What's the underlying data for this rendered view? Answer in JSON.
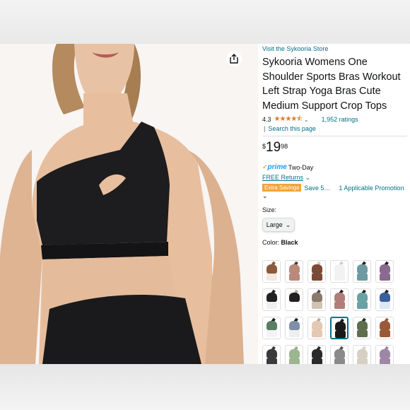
{
  "product": {
    "store_link": "Visit the Sykooria Store",
    "title": "Sykooria Womens One Shoulder Sports Bras Workout Left Strap Yoga Bras Cute Medium Support Crop Tops",
    "rating_value": "4.3",
    "stars": "★★★★⯪",
    "rating_chevron": "⌄",
    "ratings_count": "1,952 ratings",
    "search_sep": "|",
    "search_link": "Search this page",
    "price_symbol": "$",
    "price_whole": "19",
    "price_fraction": "98",
    "prime_check": "✓",
    "prime_word": "prime",
    "prime_delivery": "Two-Day",
    "returns": "FREE Returns",
    "returns_chevron": "⌄",
    "badge": "Extra Savings",
    "savings": "Save 5…",
    "promotion": "1 Applicable Promotion",
    "expand_chevron": "⌄",
    "size_label": "Size:",
    "size_value": "Large",
    "size_chevron": "⌄",
    "color_label": "Color:",
    "color_value": "Black"
  },
  "colors": {
    "link": "#007185",
    "star": "#de7921",
    "prime": "#1a98ff",
    "badge": "#f4a338",
    "swatch_selected": "#007185"
  },
  "icons": {
    "share": "share-icon"
  },
  "swatches": [
    {
      "top": "#8c5a3c",
      "lower": "#f3e9df",
      "strap": "#8c5a3c"
    },
    {
      "top": "#b9897a",
      "lower": "#b9897a",
      "strap": "#4a3a35"
    },
    {
      "top": "#7a4b36",
      "lower": "#7a4b36",
      "strap": "#d9c7b4"
    },
    {
      "top": "#f2f2f2",
      "lower": "#f2f2f2",
      "strap": "#cfcfcf"
    },
    {
      "top": "#6f9aa2",
      "lower": "#6f9aa2",
      "strap": "#222"
    },
    {
      "top": "#8a6a8e",
      "lower": "#8a6a8e",
      "strap": "#222"
    },
    {
      "top": "#222222",
      "lower": "#f0f0f0",
      "strap": "#222"
    },
    {
      "top": "#222222",
      "lower": "#ffffff",
      "strap": "#bfa9a0"
    },
    {
      "top": "#8a7a6a",
      "lower": "#cfc3b3",
      "strap": "#4a4a4a"
    },
    {
      "top": "#b07d78",
      "lower": "#b07d78",
      "strap": "#222"
    },
    {
      "top": "#6aa1a3",
      "lower": "#6aa1a3",
      "strap": "#222"
    },
    {
      "top": "#3b5f9a",
      "lower": "#dfe7f5",
      "strap": "#222"
    },
    {
      "top": "#5a7d66",
      "lower": "#f3f3f3",
      "strap": "#222"
    },
    {
      "top": "#7f8fa8",
      "lower": "#eeeeee",
      "strap": "#222"
    },
    {
      "top": "#e3c8b4",
      "lower": "#e3c8b4",
      "strap": "#c7a892"
    },
    {
      "top": "#1a1a1a",
      "lower": "#1a1a1a",
      "strap": "#1a1a1a",
      "selected": true
    },
    {
      "top": "#5f6f4e",
      "lower": "#5f6f4e",
      "strap": "#2d2d2d"
    },
    {
      "top": "#9a5a3a",
      "lower": "#9a5a3a",
      "strap": "#9a5a3a"
    },
    {
      "top": "#3a3a3a",
      "lower": "#3a3a3a",
      "strap": "#3a3a3a"
    },
    {
      "top": "#9bb58f",
      "lower": "#9bb58f",
      "strap": "#9bb58f"
    },
    {
      "top": "#2a2a2a",
      "lower": "#2a2a2a",
      "strap": "#2a2a2a"
    },
    {
      "top": "#8a8a8a",
      "lower": "#8a8a8a",
      "strap": "#555"
    },
    {
      "top": "#d8cfc4",
      "lower": "#d8cfc4",
      "strap": "#d8cfc4"
    },
    {
      "top": "#9d86a6",
      "lower": "#9d86a6",
      "strap": "#9d86a6"
    }
  ]
}
